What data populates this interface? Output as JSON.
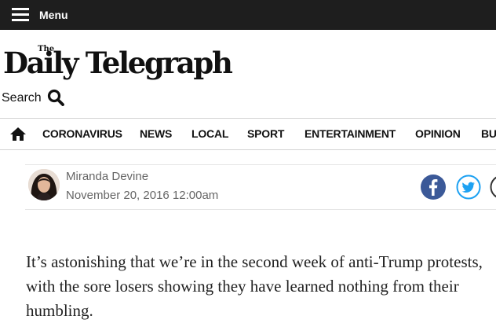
{
  "header": {
    "menu_label": "Menu",
    "masthead_small": "The",
    "masthead_name": "Daily Telegraph",
    "search_label": "Search"
  },
  "nav": {
    "items": [
      "CORONAVIRUS",
      "NEWS",
      "LOCAL",
      "SPORT",
      "ENTERTAINMENT",
      "OPINION",
      "BU"
    ]
  },
  "article": {
    "author": "Miranda Devine",
    "date": "November 20, 2016 12:00am",
    "intro": "It’s astonishing that we’re in the second week of anti-Trump protests, with the sore losers showing they have learned nothing from their humbling."
  },
  "icons": {
    "menu": "hamburger-icon",
    "search": "magnifier-icon",
    "home": "home-icon",
    "facebook": "facebook-icon",
    "twitter": "twitter-icon",
    "more": "share-more-icon"
  },
  "colors": {
    "topbar": "#1e1e1e",
    "facebook": "#3b5998",
    "twitter": "#1da1f2",
    "meta_text": "#666666"
  }
}
